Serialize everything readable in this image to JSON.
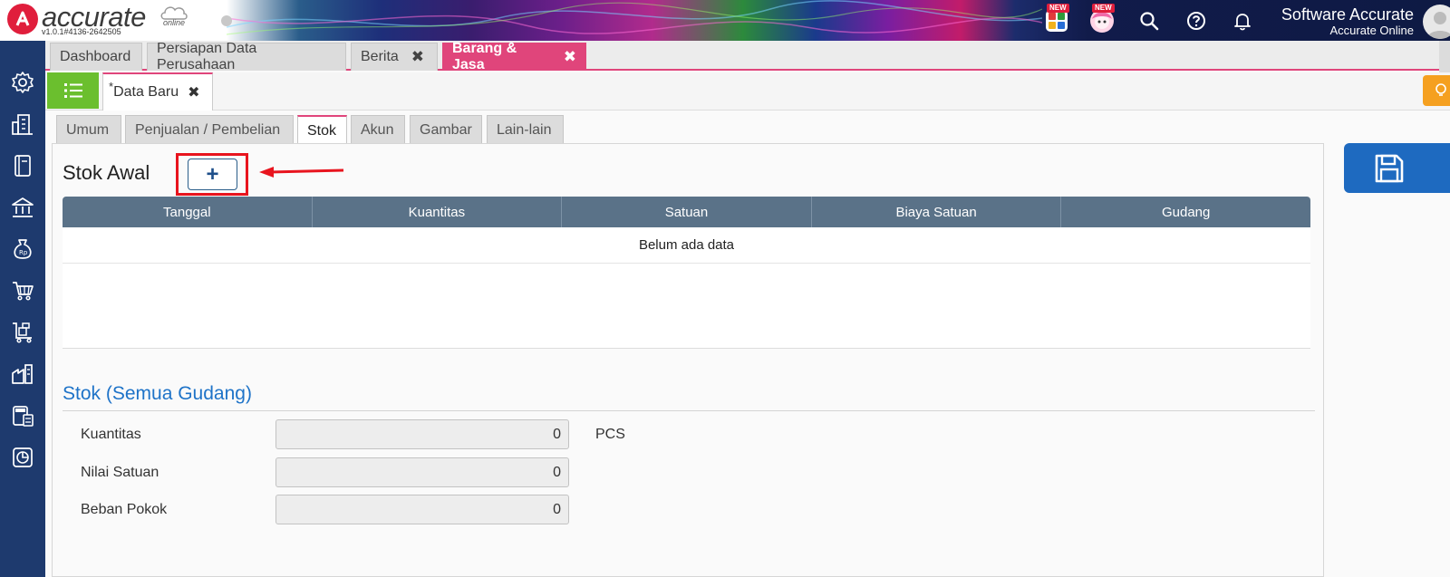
{
  "header": {
    "app_name": "accurate",
    "app_suffix": "online",
    "version": "v1.0.1#4136-2642505",
    "new_badge_1": "NEW",
    "new_badge_2": "NEW",
    "user_name": "Software Accurate",
    "user_subtitle": "Accurate Online"
  },
  "top_tabs": [
    {
      "label": "Dashboard"
    },
    {
      "label": "Persiapan Data Perusahaan"
    },
    {
      "label": "Berita",
      "close": "✖"
    },
    {
      "label": "Barang & Jasa",
      "close": "✖"
    }
  ],
  "doc_tab": {
    "marker": "*",
    "label": "Data Baru",
    "close": "✖"
  },
  "inner_tabs": [
    {
      "label": "Umum"
    },
    {
      "label": "Penjualan / Pembelian"
    },
    {
      "label": "Stok"
    },
    {
      "label": "Akun"
    },
    {
      "label": "Gambar"
    },
    {
      "label": "Lain-lain"
    }
  ],
  "stok_awal": {
    "title": "Stok Awal",
    "add_label": "+",
    "columns": [
      "Tanggal",
      "Kuantitas",
      "Satuan",
      "Biaya Satuan",
      "Gudang"
    ],
    "empty_text": "Belum ada data"
  },
  "stok_semua": {
    "title": "Stok (Semua Gudang)",
    "rows": [
      {
        "label": "Kuantitas",
        "value": "0",
        "unit": "PCS"
      },
      {
        "label": "Nilai Satuan",
        "value": "0"
      },
      {
        "label": "Beban Pokok",
        "value": "0"
      }
    ]
  },
  "colors": {
    "accent": "#e0457b",
    "sidebar": "#1e3a6e",
    "grid_header": "#5a7288",
    "section_title": "#1e73c8",
    "save_button": "#1e6ac0",
    "list_button": "#6bbf2e",
    "highlight": "#e8141e"
  },
  "icons": {
    "sidebar": [
      "settings-icon",
      "company-icon",
      "book-icon",
      "bank-icon",
      "money-bag-icon",
      "shopping-cart-icon",
      "inventory-cart-icon",
      "factory-icon",
      "tax-icon",
      "report-icon"
    ],
    "header": [
      "apps-grid-icon",
      "anime-avatar-icon",
      "search-icon",
      "help-icon",
      "bell-icon"
    ]
  }
}
